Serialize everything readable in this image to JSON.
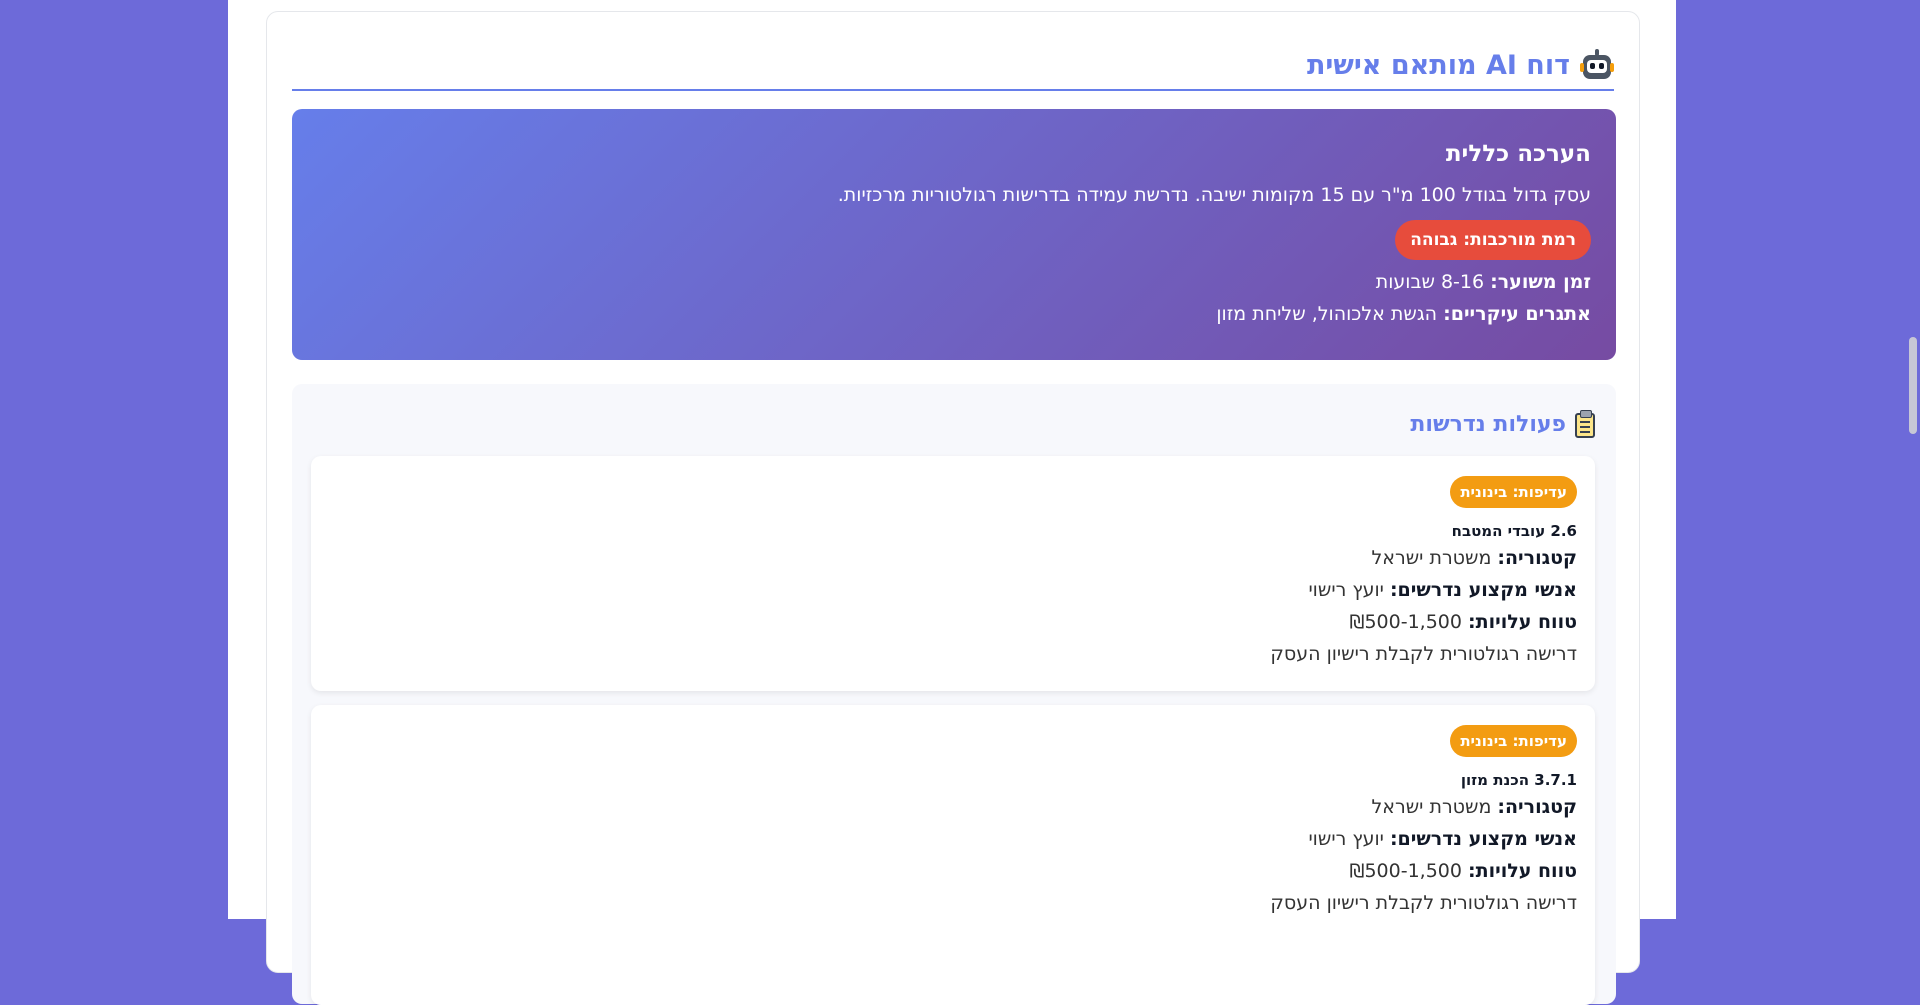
{
  "report": {
    "title": "דוח AI מותאם אישית",
    "icon": "robot-icon"
  },
  "overview": {
    "heading": "הערכה כללית",
    "description": "עסק גדול בגודל 100 מ\"ר עם 15 מקומות ישיבה. נדרשת עמידה בדרישות רגולטוריות מרכזיות.",
    "complexity_badge": "רמת מורכבות: גבוהה",
    "time_label": "זמן משוער:",
    "time_value": " 8-16 שבועות",
    "challenges_label": "אתגרים עיקריים:",
    "challenges_value": " הגשת אלכוהול, שליחת מזון"
  },
  "actions": {
    "title": "פעולות נדרשות",
    "icon": "clipboard-icon",
    "category_label": "קטגוריה:",
    "experts_label": "אנשי מקצוע נדרשים:",
    "cost_label": "טווח עלויות:",
    "items": [
      {
        "priority": "עדיפות: בינונית",
        "title": "2.6 עובדי המטבח",
        "category": " משטרת ישראל",
        "experts": " יועץ רישוי",
        "cost": " ₪500-1,500",
        "description": "דרישה רגולטורית לקבלת רישיון העסק"
      },
      {
        "priority": "עדיפות: בינונית",
        "title": "3.7.1 הכנת מזון",
        "category": " משטרת ישראל",
        "experts": " יועץ רישוי",
        "cost": " ₪500-1,500",
        "description": "דרישה רגולטורית לקבלת רישיון העסק"
      }
    ]
  },
  "colors": {
    "background": "#6d6ad9",
    "accent": "#667eea",
    "gradient_end": "#764ba2",
    "complexity_high": "#e74c3c",
    "priority_medium": "#f39c12"
  }
}
